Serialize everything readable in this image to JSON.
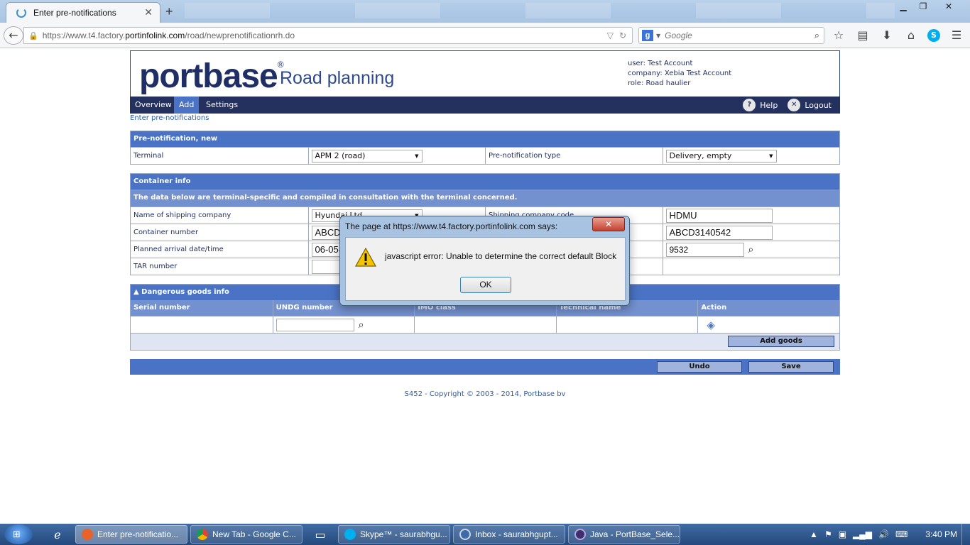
{
  "browser": {
    "tab_title": "Enter pre-notifications",
    "new_tab": "+",
    "url_prefix": "https://www.t4.factory.",
    "url_domain": "portinfolink.com",
    "url_suffix": "/road/newprenotificationrh.do",
    "search_placeholder": "Google",
    "icons": [
      "back-arrow-icon",
      "lock-icon",
      "reload-icon",
      "search-icon",
      "bookmark-star-icon",
      "reading-list-icon",
      "download-icon",
      "home-icon",
      "skype-icon",
      "menu-icon"
    ]
  },
  "header": {
    "logo": "portbase",
    "logo_mark": "®",
    "app_name": "Road planning",
    "user": "user: Test Account",
    "company": "company: Xebia Test Account",
    "role": "role: Road haulier"
  },
  "menu": {
    "overview": "Overview",
    "add": "Add",
    "settings": "Settings",
    "help": "Help",
    "logout": "Logout"
  },
  "breadcrumb": "Enter pre-notifications",
  "prenotification": {
    "title": "Pre-notification, new",
    "terminal_label": "Terminal",
    "terminal_value": "APM 2 (road)",
    "type_label": "Pre-notification type",
    "type_value": "Delivery, empty"
  },
  "container": {
    "title": "Container info",
    "subtitle": "The data below are terminal-specific and compiled in consultation with the terminal concerned.",
    "shipping_company_label": "Name of shipping company",
    "shipping_company_value": "Hyundai Ltd",
    "shipping_code_label": "Shipping company code",
    "shipping_code_value": "HDMU",
    "container_number_label": "Container number",
    "container_number_value": "ABCD",
    "container_number_right": "ABCD3140542",
    "arrival_label": "Planned arrival date/time",
    "arrival_value": "06-05-",
    "arrival_right": "9532",
    "tar_label": "TAR number"
  },
  "dangerous_goods": {
    "title": "Dangerous goods info",
    "columns": [
      "Serial number",
      "UNDG number",
      "IMO class",
      "Technical name",
      "Action"
    ],
    "add_button": "Add goods"
  },
  "actions": {
    "undo": "Undo",
    "save": "Save"
  },
  "copyright": "S452 - Copyright © 2003 - 2014, Portbase bv",
  "dialog": {
    "title": "The page at https://www.t4.factory.portinfolink.com says:",
    "message": "javascript error: Unable to determine the correct default Block",
    "ok": "OK",
    "close": "✕"
  },
  "taskbar": {
    "items": [
      "Enter pre-notificatio...",
      "New Tab - Google C...",
      "Skype™ - saurabhgu...",
      "Inbox - saurabhgupt...",
      "Java - PortBase_Sele..."
    ],
    "clock": "3:40 PM"
  }
}
